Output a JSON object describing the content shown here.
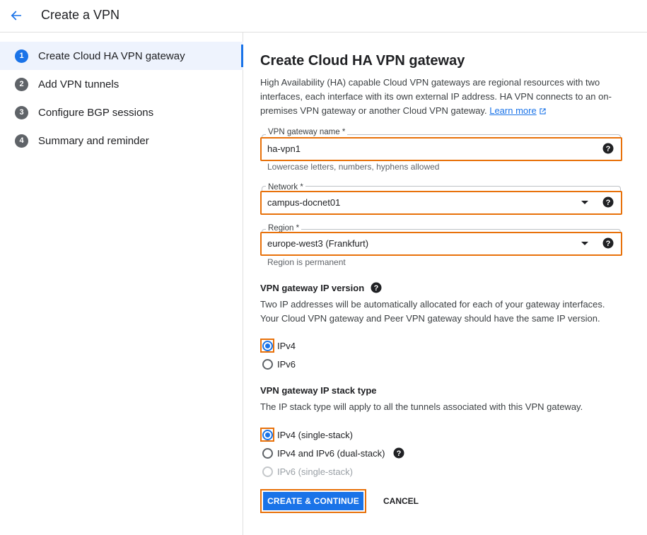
{
  "header": {
    "title": "Create a VPN"
  },
  "sidebar": {
    "steps": [
      {
        "num": "1",
        "label": "Create Cloud HA VPN gateway"
      },
      {
        "num": "2",
        "label": "Add VPN tunnels"
      },
      {
        "num": "3",
        "label": "Configure BGP sessions"
      },
      {
        "num": "4",
        "label": "Summary and reminder"
      }
    ]
  },
  "main": {
    "title": "Create Cloud HA VPN gateway",
    "intro": "High Availability (HA) capable Cloud VPN gateways are regional resources with two interfaces, each interface with its own external IP address. HA VPN connects to an on-premises VPN gateway or another Cloud VPN gateway.",
    "learn_more": "Learn more",
    "gateway_name": {
      "label": "VPN gateway name *",
      "value": "ha-vpn1",
      "hint": "Lowercase letters, numbers, hyphens allowed"
    },
    "network": {
      "label": "Network *",
      "value": "campus-docnet01"
    },
    "region": {
      "label": "Region *",
      "value": "europe-west3 (Frankfurt)",
      "hint": "Region is permanent"
    },
    "ip_version": {
      "title": "VPN gateway IP version",
      "desc": "Two IP addresses will be automatically allocated for each of your gateway interfaces. Your Cloud VPN gateway and Peer VPN gateway should have the same IP version.",
      "options": [
        "IPv4",
        "IPv6"
      ],
      "selected": "IPv4"
    },
    "stack_type": {
      "title": "VPN gateway IP stack type",
      "desc": "The IP stack type will apply to all the tunnels associated with this VPN gateway.",
      "options": [
        "IPv4 (single-stack)",
        "IPv4 and IPv6 (dual-stack)",
        "IPv6 (single-stack)"
      ],
      "selected": "IPv4 (single-stack)",
      "disabled": "IPv6 (single-stack)"
    },
    "buttons": {
      "create": "CREATE & CONTINUE",
      "cancel": "CANCEL"
    }
  },
  "colors": {
    "accent": "#1a73e8",
    "highlight": "#e8710a"
  },
  "icons": {
    "back": "arrow-left-icon",
    "help": "help-circle-icon",
    "external": "external-link-icon",
    "dropdown": "caret-down-icon"
  }
}
